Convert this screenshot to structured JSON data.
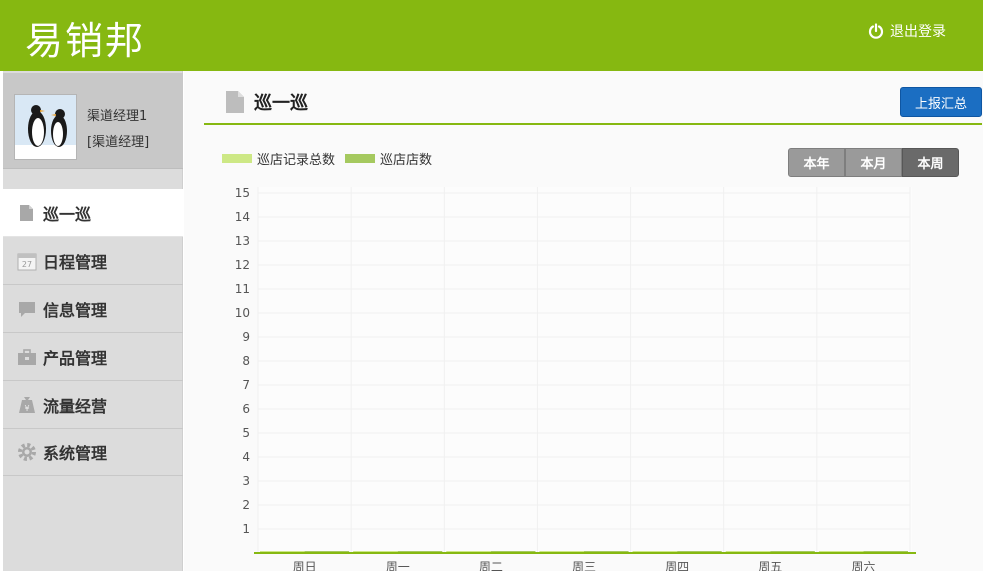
{
  "header": {
    "logo": "易销邦",
    "logout_label": "退出登录",
    "bg_color": "#86b811"
  },
  "profile": {
    "name": "渠道经理1",
    "role": "[渠道经理]"
  },
  "sidebar": {
    "items": [
      {
        "label": "巡一巡",
        "icon": "document-icon",
        "active": true
      },
      {
        "label": "日程管理",
        "icon": "calendar-icon",
        "active": false
      },
      {
        "label": "信息管理",
        "icon": "message-icon",
        "active": false
      },
      {
        "label": "产品管理",
        "icon": "briefcase-icon",
        "active": false
      },
      {
        "label": "流量经营",
        "icon": "yuan-bag-icon",
        "active": false
      },
      {
        "label": "系统管理",
        "icon": "gear-icon",
        "active": false
      }
    ]
  },
  "main": {
    "title": "巡一巡",
    "report_button": "上报汇总",
    "range_buttons": [
      "本年",
      "本月",
      "本周"
    ],
    "range_selected": "本周"
  },
  "chart_data": {
    "type": "bar",
    "categories": [
      "周日",
      "周一",
      "周二",
      "周三",
      "周四",
      "周五",
      "周六"
    ],
    "series": [
      {
        "name": "巡店记录总数",
        "values": [
          0,
          0,
          0,
          0,
          0,
          0,
          0
        ],
        "color": "#cde885"
      },
      {
        "name": "巡店店数",
        "values": [
          0,
          0,
          0,
          0,
          0,
          0,
          0
        ],
        "color": "#a5c95f"
      }
    ],
    "yticks": [
      1,
      2,
      3,
      4,
      5,
      6,
      7,
      8,
      9,
      10,
      11,
      12,
      13,
      14,
      15
    ],
    "ylim": [
      0,
      15
    ],
    "grid": true,
    "legend": "top-left"
  }
}
